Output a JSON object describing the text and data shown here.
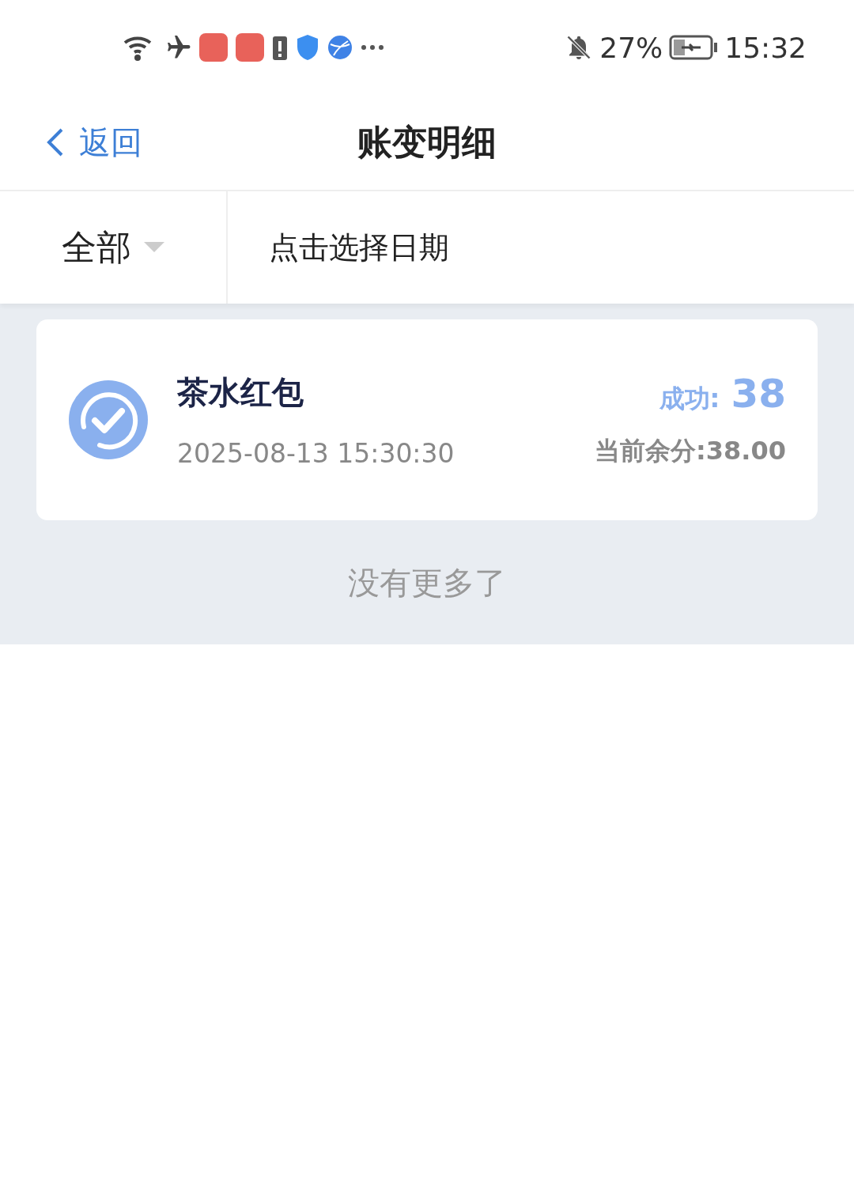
{
  "status_bar": {
    "battery": "27%",
    "time": "15:32"
  },
  "header": {
    "back": "返回",
    "title": "账变明细"
  },
  "filter": {
    "category": "全部",
    "date_placeholder": "点击选择日期"
  },
  "records": [
    {
      "title": "茶水红包",
      "time": "2025-08-13 15:30:30",
      "status": "成功:",
      "amount": "38",
      "balance": "当前余分:38.00"
    }
  ],
  "footer": "没有更多了"
}
